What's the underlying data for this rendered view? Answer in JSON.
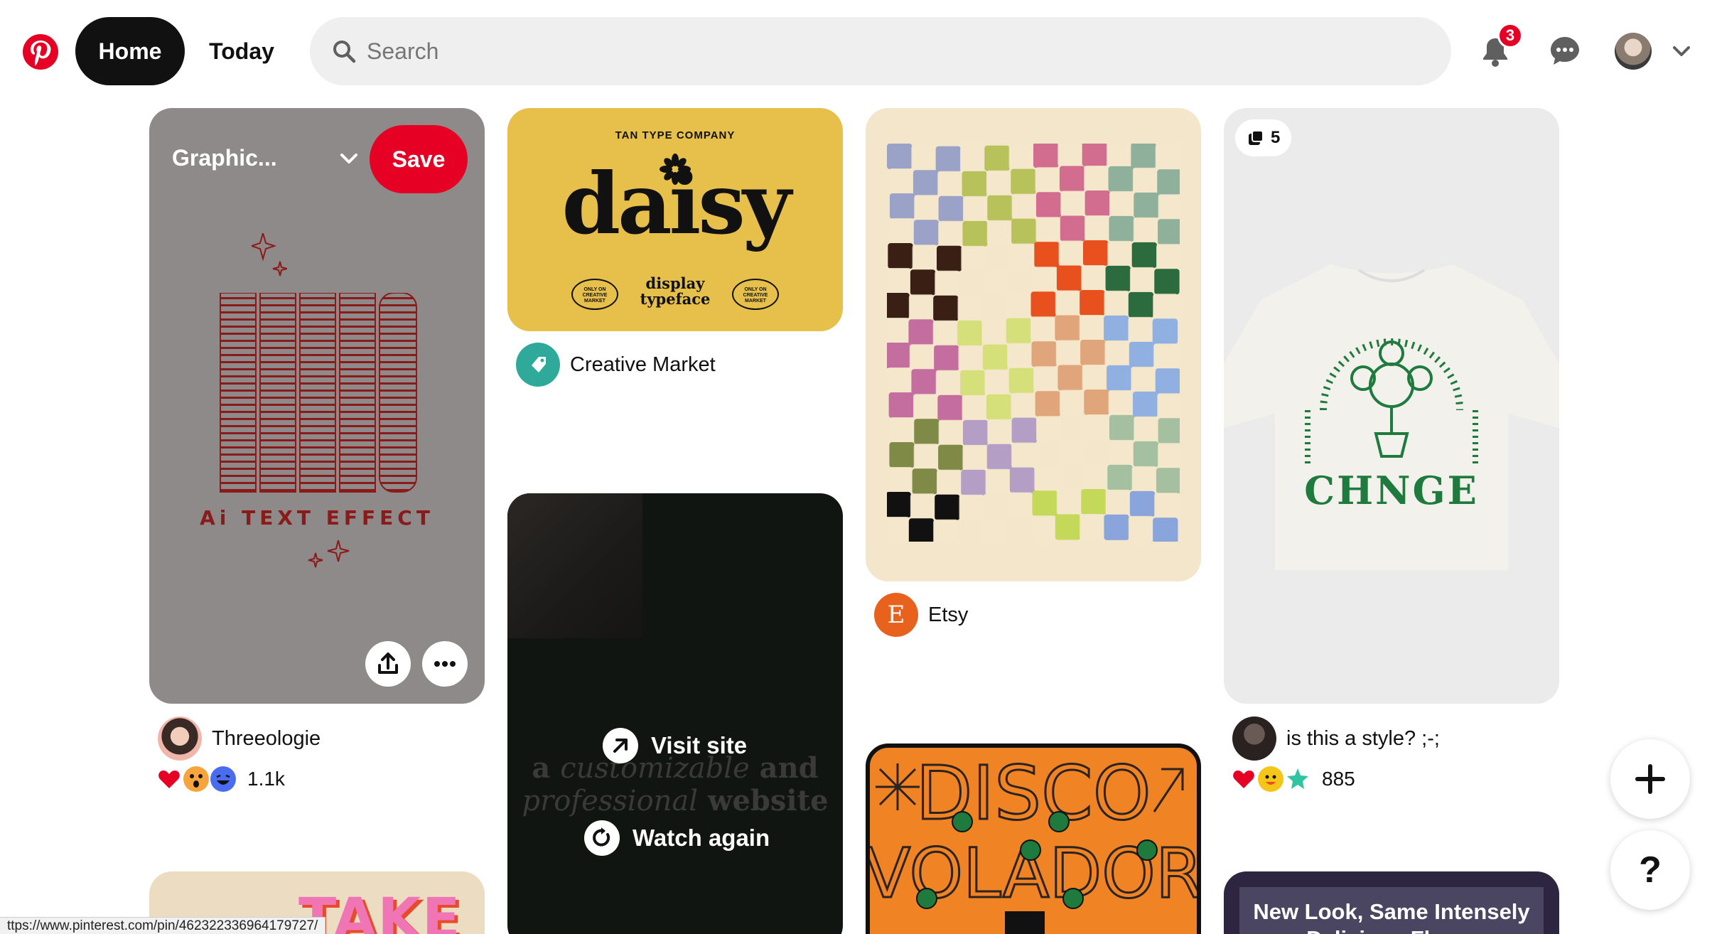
{
  "header": {
    "home_label": "Home",
    "today_label": "Today",
    "search_placeholder": "Search",
    "notification_count": "3"
  },
  "pins": {
    "blend": {
      "board_name": "Graphic...",
      "save_label": "Save",
      "title_word": "BLEND",
      "subtitle": "Ai TEXT EFFECT",
      "source": "Threeologie",
      "reactions": "1.1k"
    },
    "daisy": {
      "top_text": "TAN TYPE COMPANY",
      "word": "daisy",
      "display_line1": "display",
      "display_line2": "typeface",
      "oval_text": "ONLY ON CREATIVE MARKET",
      "source": "Creative Market"
    },
    "video": {
      "bg_line1_a": "a ",
      "bg_line1_b": "customizable",
      "bg_line1_c": " and",
      "bg_line2_a": "professional",
      "bg_line2_b": " website",
      "visit_label": "Visit site",
      "watch_label": "Watch again"
    },
    "checker": {
      "source": "Etsy",
      "source_initial": "E"
    },
    "shirt": {
      "count": "5",
      "arc_text": "ALWAYS GROWING · ALWAYS LOVING · ALWAYS BLOOMING",
      "brand": "CHNGE",
      "source": "is this a style? ;-;",
      "reactions": "885"
    },
    "disco": {
      "line1": "DISCO",
      "line2": "VOLADOR"
    },
    "take": {
      "word": "TAKE"
    },
    "newlook": {
      "line1": "New Look, Same Intensely",
      "line2": "Delicious Flavor"
    }
  },
  "floating": {
    "create_label": "+",
    "help_label": "?"
  },
  "status_bar": {
    "url": "ttps://www.pinterest.com/pin/462322336964179727/"
  },
  "colors": {
    "brand_red": "#e60023",
    "blend_bg": "#8f8a8a",
    "daisy_bg": "#e6c04a",
    "disco_orange": "#f08324",
    "shirt_green": "#1f7a3e"
  }
}
